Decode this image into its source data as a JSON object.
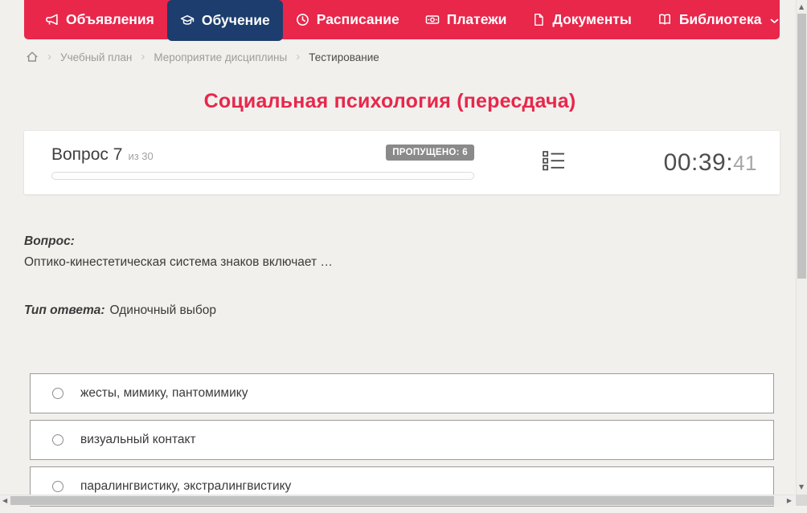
{
  "colors": {
    "nav_red": "#e8274b",
    "active_tab_navy": "#1c3d6d",
    "title_red": "#e8274b",
    "badge_gray": "#8a8a8a",
    "page_background": "#f1f0ed"
  },
  "nav": {
    "items": [
      {
        "label": "Объявления",
        "icon": "megaphone-icon",
        "active": false
      },
      {
        "label": "Обучение",
        "icon": "graduation-cap-icon",
        "active": true
      },
      {
        "label": "Расписание",
        "icon": "clock-icon",
        "active": false
      },
      {
        "label": "Платежи",
        "icon": "banknote-icon",
        "active": false
      },
      {
        "label": "Документы",
        "icon": "document-icon",
        "active": false
      },
      {
        "label": "Библиотека",
        "icon": "book-icon",
        "active": false,
        "has_dropdown": true
      }
    ]
  },
  "breadcrumb": {
    "items": [
      "Учебный план",
      "Мероприятие дисциплины",
      "Тестирование"
    ]
  },
  "page": {
    "title": "Социальная психология (пересдача)"
  },
  "quiz": {
    "question_number": "Вопрос 7",
    "question_total": "из 30",
    "skipped_badge": "ПРОПУЩЕНО: 6",
    "timer_main": "00:39:",
    "timer_seconds": "41",
    "question_heading": "Вопрос:",
    "question_text": "Оптико-кинестетическая система знаков включает …",
    "answer_type_label": "Тип ответа:",
    "answer_type_value": "Одиночный выбор",
    "options": [
      {
        "label": "жесты, мимику, пантомимику"
      },
      {
        "label": "визуальный контакт"
      },
      {
        "label": "паралингвистику, экстралингвистику"
      }
    ]
  }
}
